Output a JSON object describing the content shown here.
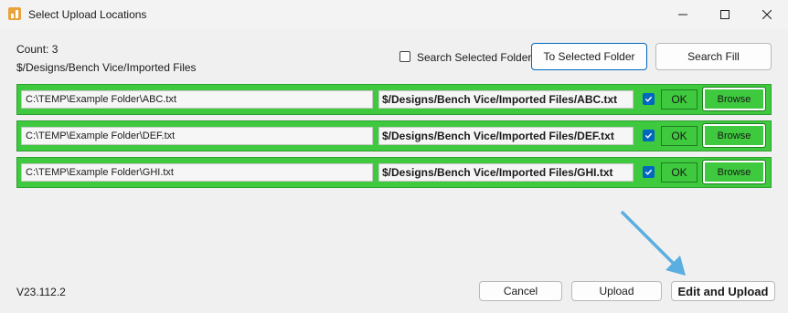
{
  "window": {
    "title": "Select Upload Locations"
  },
  "header": {
    "count": "Count: 3",
    "path": "$/Designs/Bench Vice/Imported Files",
    "search_selected_folder_label": "Search Selected Folder",
    "to_selected_folder_label": "To Selected Folder",
    "search_fill_label": "Search Fill"
  },
  "rows": [
    {
      "source": "C:\\TEMP\\Example Folder\\ABC.txt",
      "destination": "$/Designs/Bench Vice/Imported Files/ABC.txt",
      "status": "OK",
      "browse_label": "Browse",
      "checked": true
    },
    {
      "source": "C:\\TEMP\\Example Folder\\DEF.txt",
      "destination": "$/Designs/Bench Vice/Imported Files/DEF.txt",
      "status": "OK",
      "browse_label": "Browse",
      "checked": true
    },
    {
      "source": "C:\\TEMP\\Example Folder\\GHI.txt",
      "destination": "$/Designs/Bench Vice/Imported Files/GHI.txt",
      "status": "OK",
      "browse_label": "Browse",
      "checked": true
    }
  ],
  "footer": {
    "version": "V23.112.2",
    "cancel_label": "Cancel",
    "upload_label": "Upload",
    "edit_upload_label": "Edit and Upload"
  },
  "colors": {
    "row_green": "#3ec93e",
    "accent": "#0067c0",
    "arrow": "#5aaee0"
  },
  "icons": [
    "app-icon",
    "minimize-icon",
    "maximize-icon",
    "close-icon",
    "checkmark-icon",
    "arrow-annotation"
  ]
}
